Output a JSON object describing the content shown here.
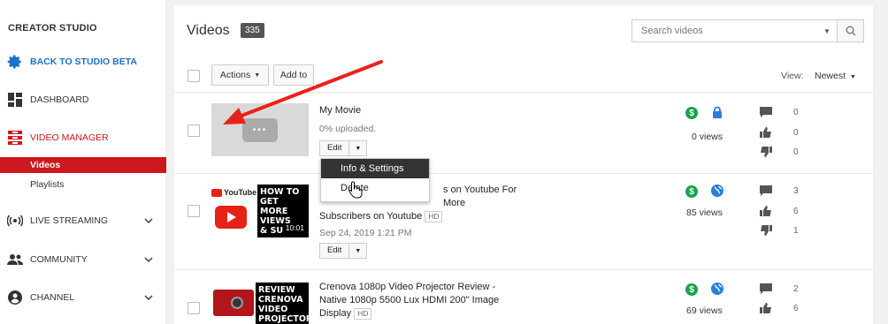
{
  "sidebar": {
    "title": "CREATOR STUDIO",
    "items": [
      {
        "label": "BACK TO STUDIO BETA",
        "icon": "gear-icon"
      },
      {
        "label": "DASHBOARD",
        "icon": "dashboard-icon"
      },
      {
        "label": "VIDEO MANAGER",
        "icon": "video-manager-icon"
      },
      {
        "label": "LIVE STREAMING",
        "icon": "live-icon"
      },
      {
        "label": "COMMUNITY",
        "icon": "people-icon"
      },
      {
        "label": "CHANNEL",
        "icon": "channel-icon"
      }
    ],
    "subitems": [
      {
        "label": "Videos",
        "active": true
      },
      {
        "label": "Playlists",
        "active": false
      }
    ]
  },
  "header": {
    "title": "Videos",
    "count": "335"
  },
  "search": {
    "placeholder": "Search videos"
  },
  "toolbar": {
    "actions_label": "Actions",
    "addto_label": "Add to",
    "view_label": "View:",
    "view_value": "Newest"
  },
  "videos": [
    {
      "title": "My Movie",
      "status": "0% uploaded.",
      "views": "0 views",
      "privacy": "private",
      "comments": "0",
      "likes": "0",
      "dislikes": "0",
      "edit_label": "Edit"
    },
    {
      "title_line1": "s on Youtube For",
      "title_line2": "More",
      "title_line3": "Subscribers on Youtube",
      "hd": "HD",
      "date": "Sep 24, 2019 1:21 PM",
      "views": "85 views",
      "privacy": "public",
      "comments": "3",
      "likes": "6",
      "dislikes": "1",
      "edit_label": "Edit",
      "thumb_text": [
        "HOW TO",
        "GET MORE",
        "VIEWS",
        "& SU"
      ],
      "thumb_brand": "YouTube",
      "duration": "10:01"
    },
    {
      "title_line1": "Crenova 1080p Video Projector Review -",
      "title_line2": "Native 1080p 5500 Lux HDMI 200\" Image",
      "title_line3": "Display",
      "hd": "HD",
      "views": "69 views",
      "privacy": "public",
      "comments": "2",
      "likes": "6",
      "thumb_text": [
        "REVIEW",
        "CRENOVA",
        "VIDEO",
        "PROJECTOR"
      ]
    }
  ],
  "edit_menu": {
    "items": [
      "Info & Settings",
      "Delete"
    ]
  },
  "colors": {
    "accent_red": "#cc181e",
    "link_blue": "#1a73c8",
    "money_green": "#18a44a",
    "annotation_arrow": "#e8221b"
  }
}
